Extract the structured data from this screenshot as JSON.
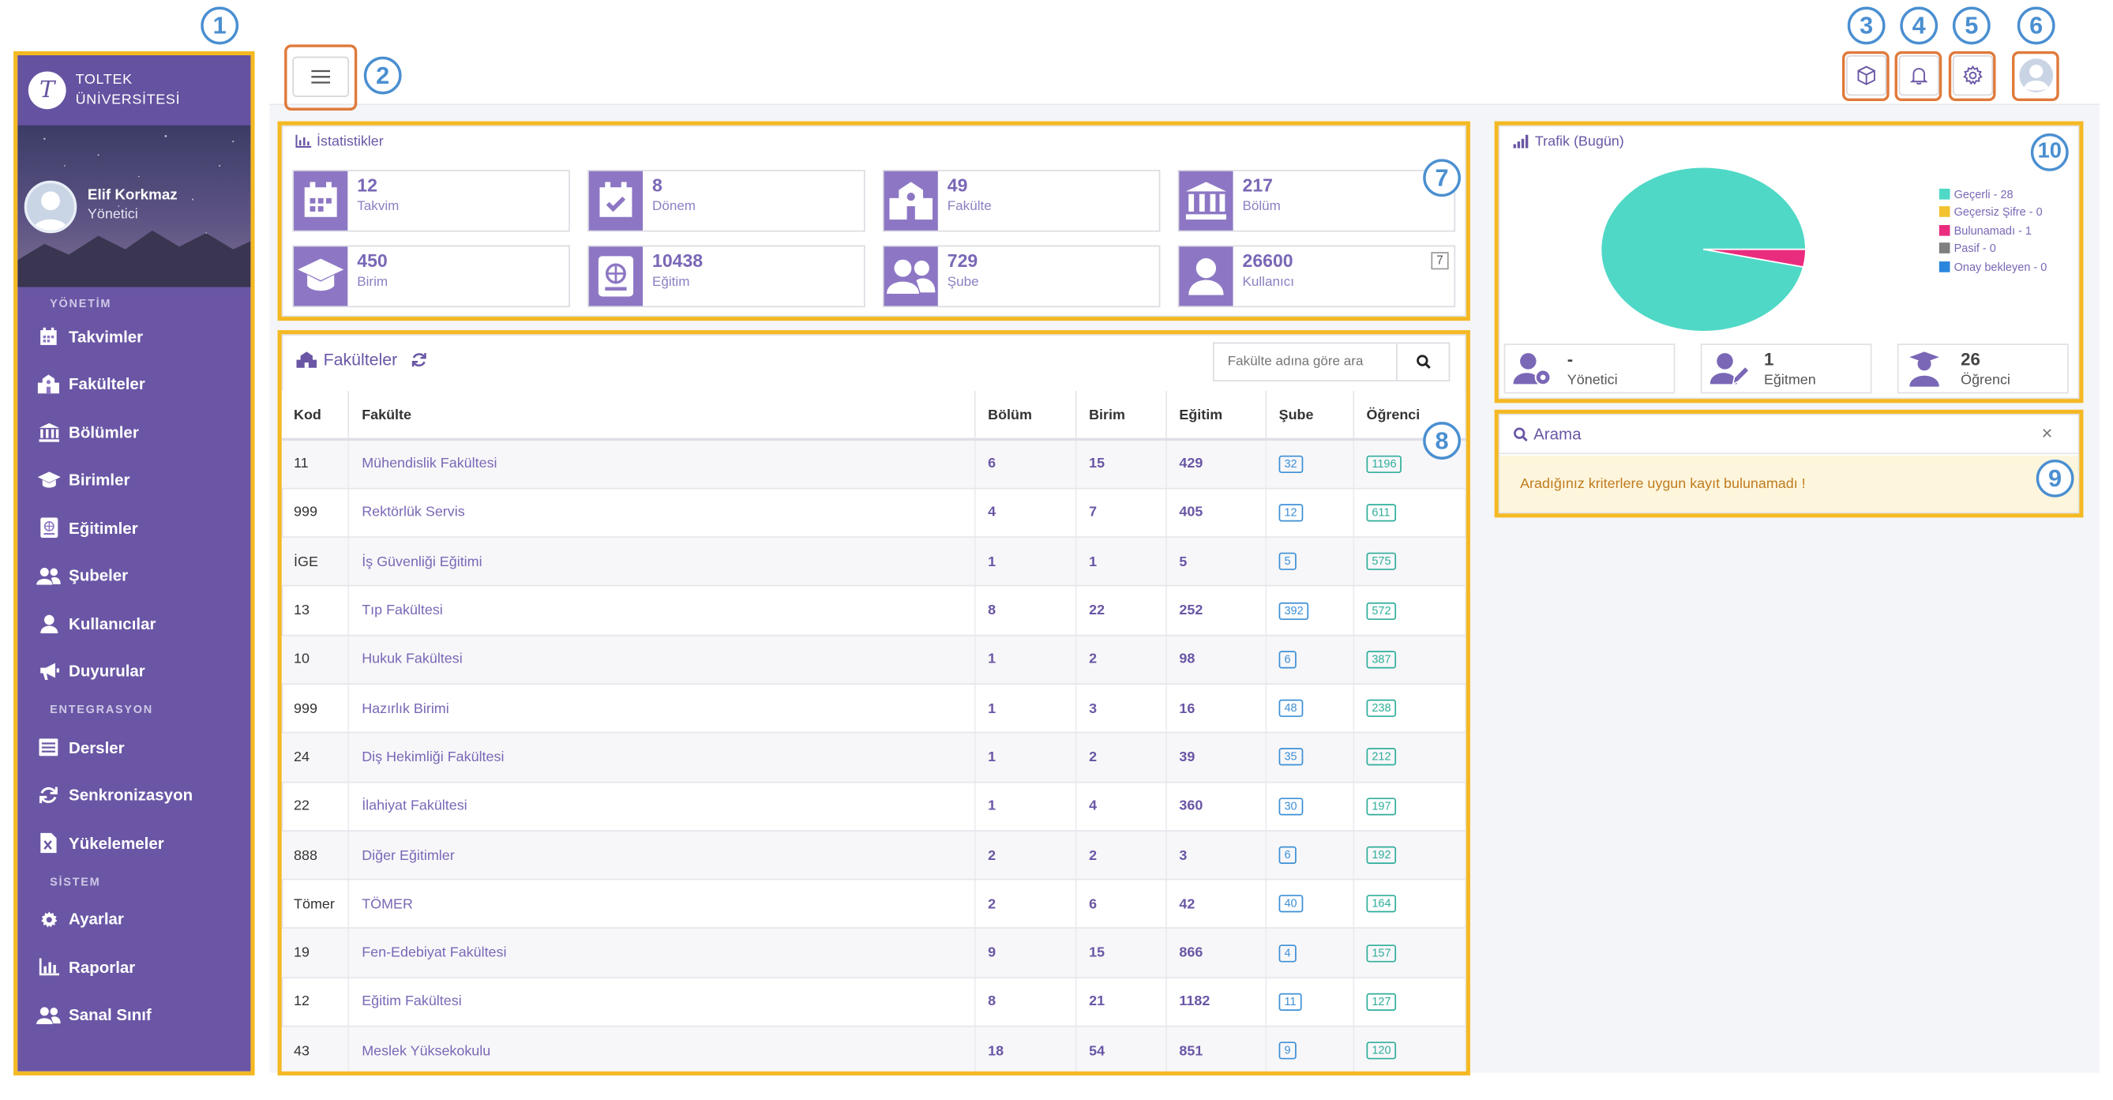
{
  "brand": {
    "line1": "TOLTEK",
    "line2": "ÜNİVERSİTESİ",
    "logo_letter": "T"
  },
  "user": {
    "name": "Elif Korkmaz",
    "role": "Yönetici"
  },
  "sidebar": {
    "sections": [
      {
        "title": "YÖNETİM",
        "items": [
          {
            "label": "Takvimler",
            "icon": "calendar-icon"
          },
          {
            "label": "Fakülteler",
            "icon": "school-icon"
          },
          {
            "label": "Bölümler",
            "icon": "university-icon"
          },
          {
            "label": "Birimler",
            "icon": "graduation-cap-icon"
          },
          {
            "label": "Eğitimler",
            "icon": "book-icon"
          },
          {
            "label": "Şubeler",
            "icon": "users-icon"
          },
          {
            "label": "Kullanıcılar",
            "icon": "user-icon"
          },
          {
            "label": "Duyurular",
            "icon": "megaphone-icon"
          }
        ]
      },
      {
        "title": "ENTEGRASYON",
        "items": [
          {
            "label": "Dersler",
            "icon": "list-icon"
          },
          {
            "label": "Senkronizasyon",
            "icon": "sync-icon"
          },
          {
            "label": "Yükelemeler",
            "icon": "excel-file-icon"
          }
        ]
      },
      {
        "title": "SİSTEM",
        "items": [
          {
            "label": "Ayarlar",
            "icon": "gear-icon"
          },
          {
            "label": "Raporlar",
            "icon": "bar-chart-icon"
          },
          {
            "label": "Sanal Sınıf",
            "icon": "users-icon"
          }
        ]
      }
    ]
  },
  "annotations": [
    "1",
    "2",
    "3",
    "4",
    "5",
    "6",
    "7",
    "8",
    "9",
    "10"
  ],
  "stats": {
    "title": "İstatistikler",
    "items": [
      {
        "value": "12",
        "label": "Takvim",
        "icon": "calendar-icon"
      },
      {
        "value": "8",
        "label": "Dönem",
        "icon": "calendar-check-icon"
      },
      {
        "value": "49",
        "label": "Fakülte",
        "icon": "school-icon"
      },
      {
        "value": "217",
        "label": "Bölüm",
        "icon": "university-icon"
      },
      {
        "value": "450",
        "label": "Birim",
        "icon": "graduation-cap-icon"
      },
      {
        "value": "10438",
        "label": "Eğitim",
        "icon": "book-icon"
      },
      {
        "value": "729",
        "label": "Şube",
        "icon": "users-icon"
      },
      {
        "value": "26600",
        "label": "Kullanıcı",
        "icon": "user-icon",
        "badge": "7"
      }
    ]
  },
  "faculties": {
    "title": "Fakülteler",
    "search_placeholder": "Fakülte adına göre ara",
    "columns": [
      "Kod",
      "Fakülte",
      "Bölüm",
      "Birim",
      "Eğitim",
      "Şube",
      "Öğrenci"
    ],
    "rows": [
      [
        "11",
        "Mühendislik Fakültesi",
        "6",
        "15",
        "429",
        "32",
        "1196"
      ],
      [
        "999",
        "Rektörlük Servis",
        "4",
        "7",
        "405",
        "12",
        "611"
      ],
      [
        "İGE",
        "İş Güvenliği Eğitimi",
        "1",
        "1",
        "5",
        "5",
        "575"
      ],
      [
        "13",
        "Tıp Fakültesi",
        "8",
        "22",
        "252",
        "392",
        "572"
      ],
      [
        "10",
        "Hukuk Fakültesi",
        "1",
        "2",
        "98",
        "6",
        "387"
      ],
      [
        "999",
        "Hazırlık Birimi",
        "1",
        "3",
        "16",
        "48",
        "238"
      ],
      [
        "24",
        "Diş Hekimliği Fakültesi",
        "1",
        "2",
        "39",
        "35",
        "212"
      ],
      [
        "22",
        "İlahiyat Fakültesi",
        "1",
        "4",
        "360",
        "30",
        "197"
      ],
      [
        "888",
        "Diğer Eğitimler",
        "2",
        "2",
        "3",
        "6",
        "192"
      ],
      [
        "Tömer",
        "TÖMER",
        "2",
        "6",
        "42",
        "40",
        "164"
      ],
      [
        "19",
        "Fen-Edebiyat Fakültesi",
        "9",
        "15",
        "866",
        "4",
        "157"
      ],
      [
        "12",
        "Eğitim Fakültesi",
        "8",
        "21",
        "1182",
        "11",
        "127"
      ],
      [
        "43",
        "Meslek Yüksekokulu",
        "18",
        "54",
        "851",
        "9",
        "120"
      ]
    ]
  },
  "traffic": {
    "title": "Trafik (Bugün)",
    "legend": [
      {
        "label": "Geçerli - 28",
        "color": "#4fd8c6"
      },
      {
        "label": "Geçersiz Şifre - 0",
        "color": "#f2c230"
      },
      {
        "label": "Bulunamadı - 1",
        "color": "#ea2c7e"
      },
      {
        "label": "Pasif - 0",
        "color": "#7f7f7f"
      },
      {
        "label": "Onay bekleyen - 0",
        "color": "#2b86dd"
      }
    ],
    "user_stats": [
      {
        "value": "-",
        "label": "Yönetici",
        "icon": "user-gear-icon"
      },
      {
        "value": "1",
        "label": "Eğitmen",
        "icon": "user-edit-icon"
      },
      {
        "value": "26",
        "label": "Öğrenci",
        "icon": "user-graduate-icon"
      }
    ]
  },
  "chart_data": {
    "type": "pie",
    "title": "Trafik (Bugün)",
    "categories": [
      "Geçerli",
      "Geçersiz Şifre",
      "Bulunamadı",
      "Pasif",
      "Onay bekleyen"
    ],
    "values": [
      28,
      0,
      1,
      0,
      0
    ],
    "colors": [
      "#4fd8c6",
      "#f2c230",
      "#ea2c7e",
      "#7f7f7f",
      "#2b86dd"
    ],
    "legend": "right"
  },
  "search_panel": {
    "title": "Arama",
    "close": "×",
    "message": "Aradığınız kriterlere uygun kayıt bulunamadı !"
  }
}
